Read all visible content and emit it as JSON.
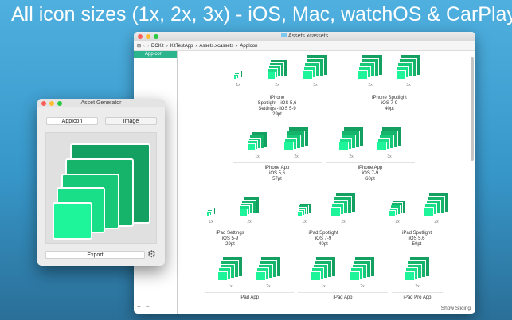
{
  "headline": "All icon sizes (1x, 2x, 3x) - iOS, Mac, watchOS & CarPlay",
  "xcode": {
    "title": "Assets.xcassets",
    "breadcrumb": [
      "DCKit",
      "KitTestApp",
      "Assets.xcassets",
      "AppIcon"
    ],
    "sidebar_selected": "AppIcon",
    "show_slicing": "Show Slicing",
    "add": "+",
    "remove": "−"
  },
  "groups": [
    {
      "slots": [
        "1x",
        "2x",
        "3x"
      ],
      "lines": [
        "iPhone",
        "Spotlight - iOS 5,6",
        "Settings - iOS 5-9",
        "29pt"
      ]
    },
    {
      "slots": [
        "2x",
        "3x"
      ],
      "lines": [
        "iPhone Spotlight",
        "iOS 7-9",
        "40pt"
      ]
    },
    {
      "slots": [
        "1x",
        "2x"
      ],
      "lines": [
        "iPhone App",
        "iOS 5,6",
        "57pt"
      ]
    },
    {
      "slots": [
        "2x",
        "3x"
      ],
      "lines": [
        "iPhone App",
        "iOS 7-9",
        "60pt"
      ]
    },
    {
      "slots": [
        "1x",
        "2x"
      ],
      "lines": [
        "iPad Settings",
        "iOS 5-9",
        "29pt"
      ]
    },
    {
      "slots": [
        "1x",
        "2x"
      ],
      "lines": [
        "iPad Spotlight",
        "iOS 7-9",
        "40pt"
      ]
    },
    {
      "slots": [
        "1x",
        "2x"
      ],
      "lines": [
        "iPad Spotlight",
        "iOS 5,6",
        "50pt"
      ]
    },
    {
      "slots": [
        "1x",
        "2x"
      ],
      "lines": [
        "iPad App"
      ]
    },
    {
      "slots": [
        "1x",
        "2x"
      ],
      "lines": [
        "iPad App"
      ]
    },
    {
      "slots": [
        "2x"
      ],
      "lines": [
        "iPad Pro App"
      ]
    }
  ],
  "generator": {
    "title": "Asset Generator",
    "tab_appicon": "AppIcon",
    "tab_image": "Image",
    "export": "Export"
  },
  "colors": {
    "accent": "#2ab58f",
    "icon_dark": "#14a060",
    "icon_light": "#1ef59a"
  }
}
